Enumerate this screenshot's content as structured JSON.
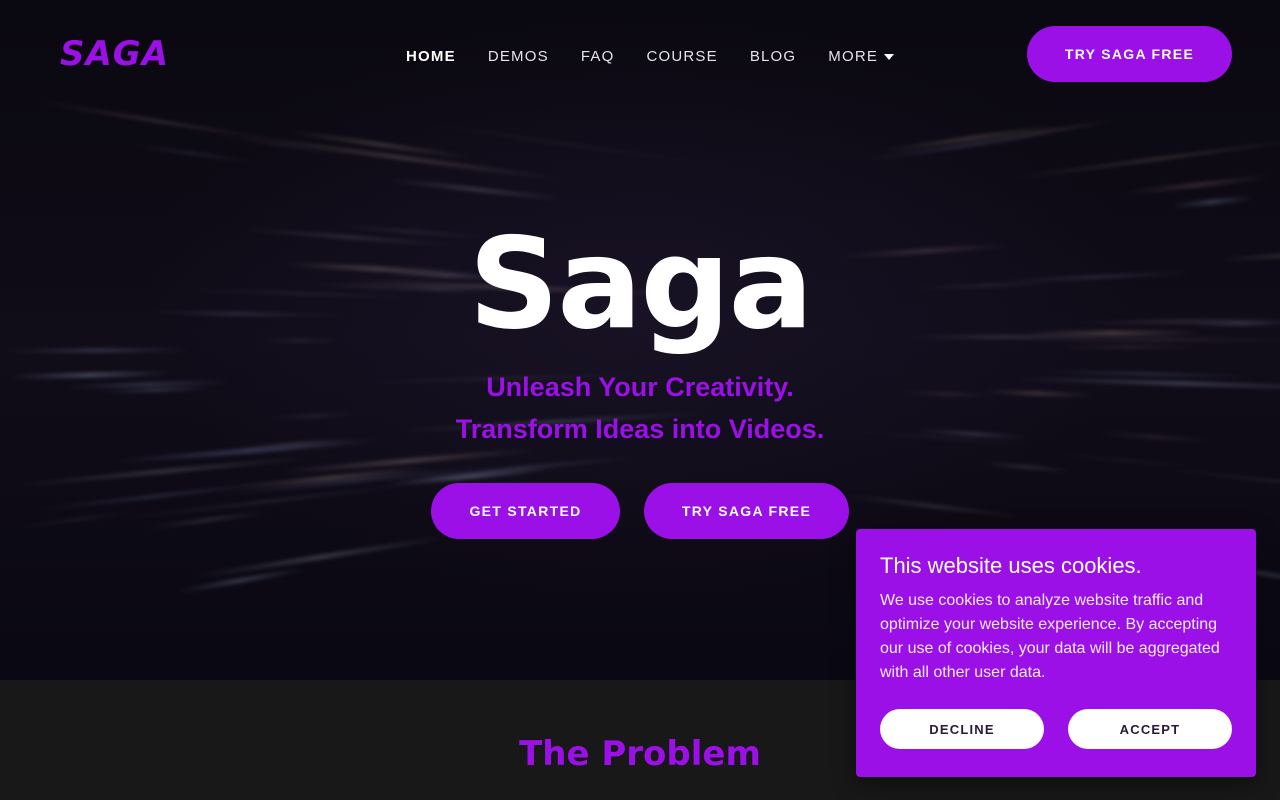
{
  "brand": {
    "logo_text": "SAGA",
    "accent_color": "#9b10e6"
  },
  "nav": {
    "items": [
      {
        "label": "HOME"
      },
      {
        "label": "DEMOS"
      },
      {
        "label": "FAQ"
      },
      {
        "label": "COURSE"
      },
      {
        "label": "BLOG"
      },
      {
        "label": "MORE"
      }
    ],
    "active_index": 0,
    "cta_label": "TRY SAGA FREE"
  },
  "hero": {
    "title": "Saga",
    "tagline_line1": "Unleash Your Creativity.",
    "tagline_line2": "Transform Ideas into Videos.",
    "primary_button": "GET STARTED",
    "secondary_button": "TRY SAGA FREE"
  },
  "problem": {
    "title": "The Problem"
  },
  "cookie_banner": {
    "title": "This website uses cookies.",
    "body": "We use cookies to analyze website traffic and optimize your website experience. By accepting our use of cookies, your data will be aggregated with all other user data.",
    "decline_label": "DECLINE",
    "accept_label": "ACCEPT"
  },
  "icons": {
    "more_dropdown": "chevron-down-icon"
  }
}
